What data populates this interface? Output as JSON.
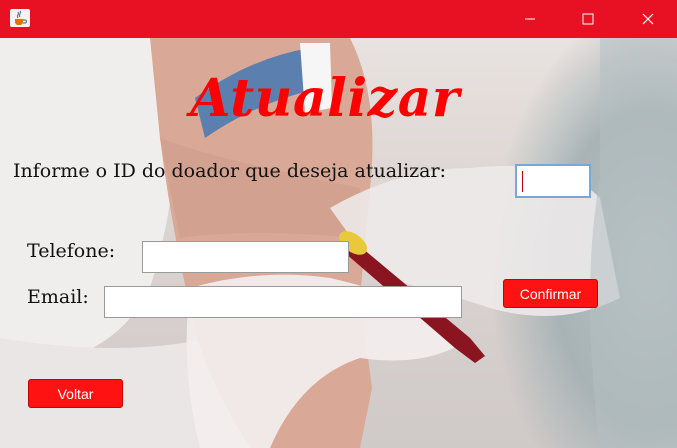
{
  "window": {
    "icon": "java-cup-icon",
    "controls": {
      "minimize": "minimize-icon",
      "maximize": "maximize-icon",
      "close": "close-icon"
    }
  },
  "form": {
    "heading": "Atualizar",
    "id_prompt": "Informe o ID do doador que deseja atualizar:",
    "id_value": "",
    "phone_label": "Telefone:",
    "phone_value": "",
    "email_label": "Email:",
    "email_value": "",
    "confirm_label": "Confirmar",
    "back_label": "Voltar"
  },
  "colors": {
    "titlebar": "#e81123",
    "heading": "#ff0000",
    "button": "#ff1212"
  }
}
